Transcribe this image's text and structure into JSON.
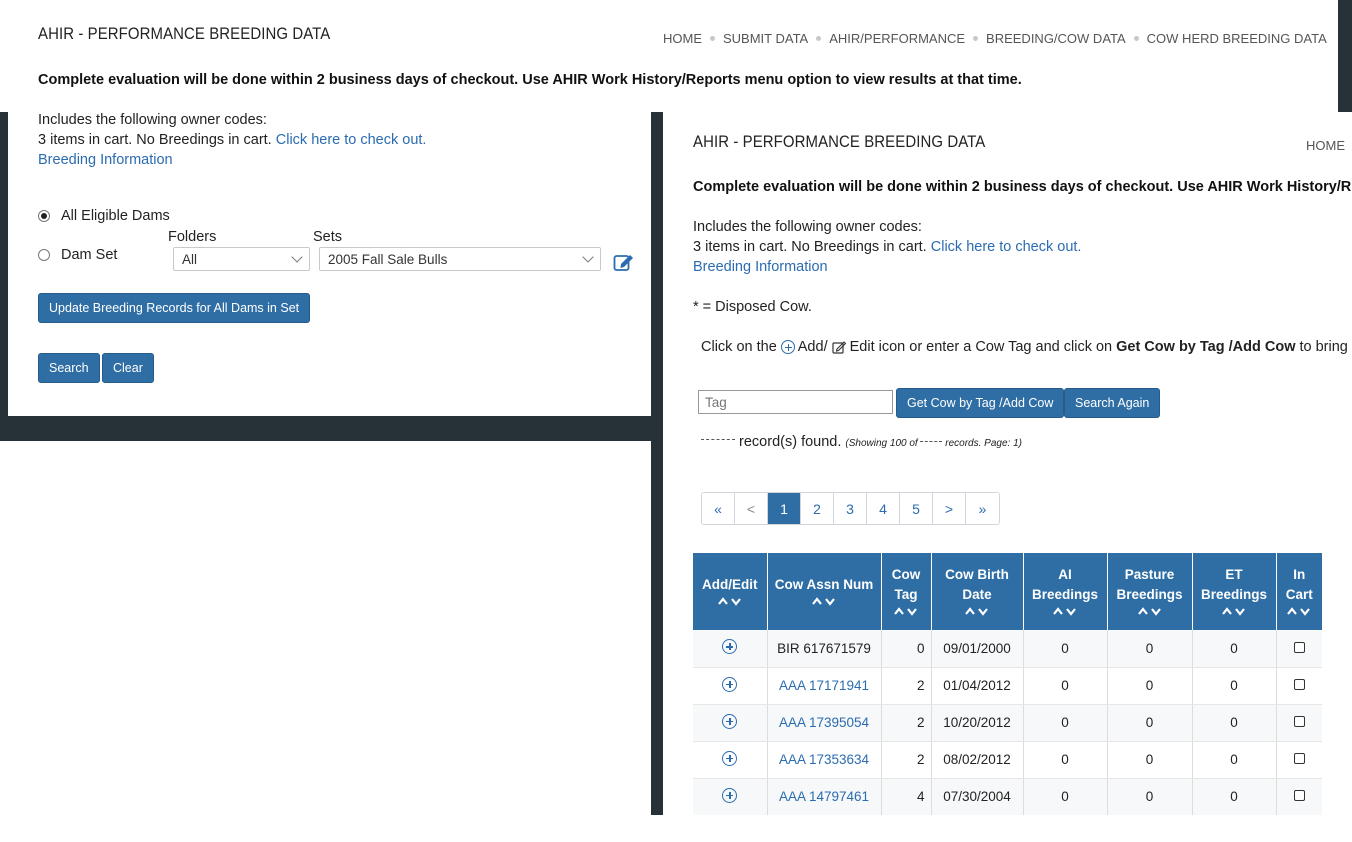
{
  "background_window": {
    "title": "AHIR - PERFORMANCE BREEDING DATA",
    "breadcrumbs": [
      "HOME",
      "SUBMIT DATA",
      "AHIR/PERFORMANCE",
      "BREEDING/COW DATA",
      "COW HERD BREEDING DATA"
    ],
    "note": "Complete evaluation will be done within 2 business days of checkout. Use AHIR Work History/Reports menu option to view results at that time.",
    "owner_codes_label": "Includes the following owner codes:",
    "cart_status": "3 items in cart. No Breedings in cart.",
    "checkout_link": "Click here to check out.",
    "breeding_info_link": "Breeding Information",
    "radio_all_dams": "All Eligible Dams",
    "radio_dam_set": "Dam Set",
    "folders_label": "Folders",
    "folders_value": "All",
    "sets_label": "Sets",
    "sets_value": "2005 Fall Sale Bulls",
    "update_button": "Update Breeding Records for All Dams in Set",
    "search_button": "Search",
    "clear_button": "Clear"
  },
  "foreground_window": {
    "title": "AHIR - PERFORMANCE BREEDING DATA",
    "home_link": "HOME",
    "note": "Complete evaluation will be done within 2 business days of checkout. Use AHIR Work History/R",
    "owner_codes_label": "Includes the following owner codes:",
    "cart_status": "3 items in cart. No Breedings in cart.",
    "checkout_link": "Click here to check out.",
    "breeding_info_link": "Breeding Information",
    "disposed_note": "* = Disposed Cow.",
    "instruction": {
      "prefix": "Click on the",
      "add": "Add/",
      "edit": "Edit icon or enter a Cow Tag and click on",
      "bold": "Get Cow by Tag /Add Cow",
      "suffix": "to bring"
    },
    "tag_placeholder": "Tag",
    "get_cow_button": "Get Cow by Tag /Add Cow",
    "search_again_button": "Search Again",
    "records_found": "record(s) found.",
    "showing_prefix": "(Showing 100 of",
    "showing_suffix": "records. Page: 1)",
    "pager": [
      "«",
      "<",
      "1",
      "2",
      "3",
      "4",
      "5",
      ">",
      "»"
    ],
    "pager_active": "1",
    "table": {
      "headers": [
        "Add/Edit",
        "Cow Assn Num",
        "Cow Tag",
        "Cow Birth Date",
        "AI Breedings",
        "Pasture Breedings",
        "ET Breedings",
        "In Cart"
      ],
      "rows": [
        {
          "assn": "BIR 617671579",
          "assn_link": false,
          "tag": "0",
          "birth": "09/01/2000",
          "ai": "0",
          "pasture": "0",
          "et": "0"
        },
        {
          "assn": "AAA 17171941",
          "assn_link": true,
          "tag": "2",
          "birth": "01/04/2012",
          "ai": "0",
          "pasture": "0",
          "et": "0"
        },
        {
          "assn": "AAA 17395054",
          "assn_link": true,
          "tag": "2",
          "birth": "10/20/2012",
          "ai": "0",
          "pasture": "0",
          "et": "0"
        },
        {
          "assn": "AAA 17353634",
          "assn_link": true,
          "tag": "2",
          "birth": "08/02/2012",
          "ai": "0",
          "pasture": "0",
          "et": "0"
        },
        {
          "assn": "AAA 14797461",
          "assn_link": true,
          "tag": "4",
          "birth": "07/30/2004",
          "ai": "0",
          "pasture": "0",
          "et": "0"
        }
      ]
    }
  },
  "colors": {
    "accent": "#2f6ea5",
    "link": "#2b6cb0",
    "dark_frame": "#263238"
  }
}
